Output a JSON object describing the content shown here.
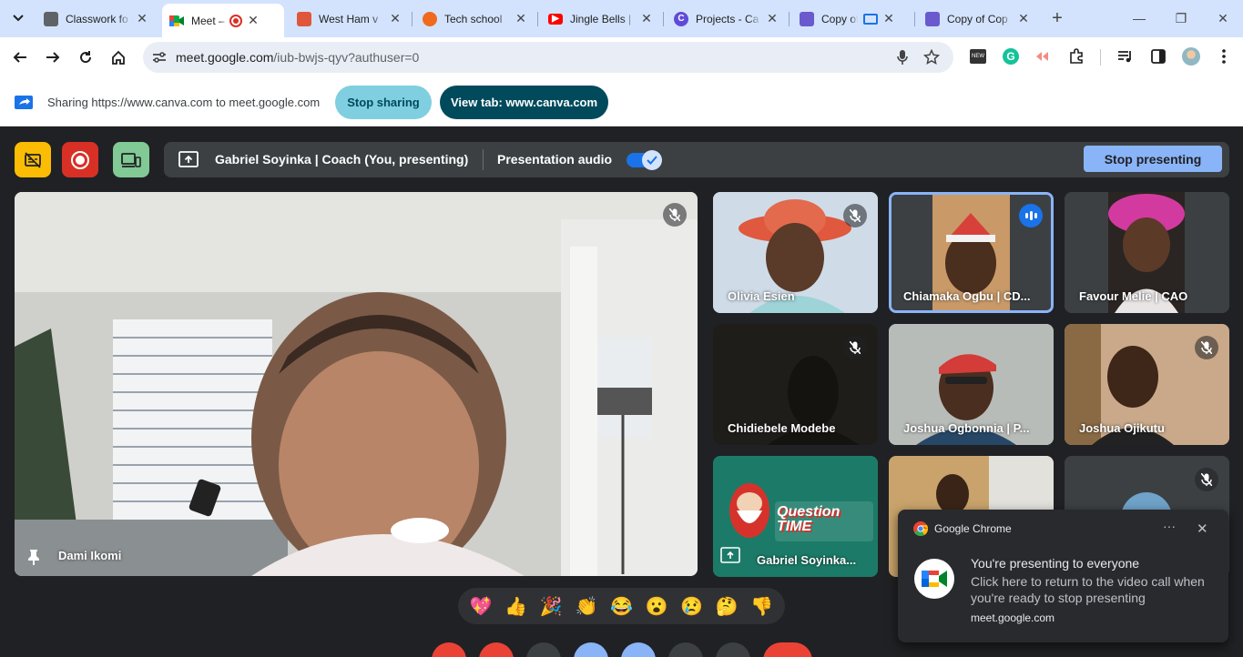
{
  "browser": {
    "tabs": [
      {
        "title": "Classwork fo",
        "icon": "classroom-icon",
        "color": "#5f6368"
      },
      {
        "title": "Meet – i",
        "icon": "meet-icon",
        "color": "#00897b",
        "active": true,
        "recording": true
      },
      {
        "title": "West Ham v",
        "icon": "news-icon",
        "color": "#e0563b"
      },
      {
        "title": "Tech school",
        "icon": "puzzle-icon",
        "color": "#f06a1d"
      },
      {
        "title": "Jingle Bells |",
        "icon": "youtube-icon",
        "color": "#ff0000"
      },
      {
        "title": "Projects - Ca",
        "icon": "canva-icon",
        "color": "#5f4bd8"
      },
      {
        "title": "Copy of",
        "icon": "extension-icon",
        "color": "#6a5acd"
      },
      {
        "title": "Copy of Cop",
        "icon": "extension-icon",
        "color": "#6a5acd"
      }
    ],
    "url_host": "meet.google.com",
    "url_path": "/iub-bwjs-qyv?authuser=0"
  },
  "sharebar": {
    "text": "Sharing https://www.canva.com to meet.google.com",
    "stop_sharing": "Stop sharing",
    "view_tab": "View tab: www.canva.com"
  },
  "meet": {
    "presenting_label": "Gabriel Soyinka | Coach (You, presenting)",
    "presentation_audio": "Presentation audio",
    "stop_presenting": "Stop presenting",
    "main_participant": "Dami Ikomi",
    "tiles": [
      {
        "name": "Olivia Esien",
        "muted": true
      },
      {
        "name": "Chiamaka Ogbu | CD...",
        "speaking": true
      },
      {
        "name": "Favour Melie | CAO",
        "muted": false
      },
      {
        "name": "Chidiebele Modebe",
        "muted": true
      },
      {
        "name": "Joshua Ogbonnia | P...",
        "muted": false
      },
      {
        "name": "Joshua Ojikutu",
        "muted": true
      },
      {
        "name": "Gabriel Soyinka...",
        "presenting": true,
        "slide_text": "Question TIME"
      },
      {
        "name": "",
        "muted": false
      },
      {
        "name": "",
        "muted": true
      }
    ],
    "reactions": [
      "💖",
      "👍",
      "🎉",
      "👏",
      "😂",
      "😮",
      "😢",
      "🤔",
      "👎"
    ]
  },
  "notification": {
    "source": "Google Chrome",
    "title": "You're presenting to everyone",
    "body": "Click here to return to the video call when you're ready to stop presenting",
    "site": "meet.google.com",
    "more": "···",
    "close": "✕"
  },
  "colors": {
    "tabbar": "#d3e3fd",
    "meet_bg": "#202124",
    "accent_blue": "#8ab4f8",
    "teal_dark": "#004a5c"
  }
}
